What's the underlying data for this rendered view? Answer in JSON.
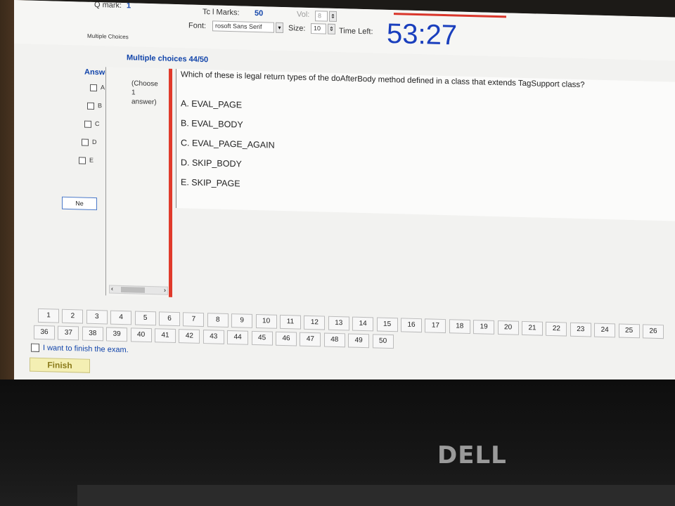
{
  "header": {
    "q_mark_label": "Q mark:",
    "q_mark_value": "1",
    "total_marks_label": "Tc  l Marks:",
    "total_marks_value": "50",
    "vol_label": "Vol:",
    "vol_value": "8",
    "font_label": "Font:",
    "font_value": "rosoft Sans Serif",
    "size_label": "Size:",
    "size_value": "10",
    "time_left_label": "Time Left:",
    "timer": "53:27",
    "mode": "Multiple Choices"
  },
  "section_title": "Multiple choices 44/50",
  "answer_panel": {
    "heading": "Answer",
    "options": [
      "A",
      "B",
      "C",
      "D",
      "E"
    ],
    "next_label": "Ne"
  },
  "hint": {
    "line1": "(Choose",
    "line2": "1",
    "line3": "answer)"
  },
  "question": {
    "text": "Which of these is legal return types of the doAfterBody method defined in a class that extends TagSupport class?",
    "options": [
      "A. EVAL_PAGE",
      "B. EVAL_BODY",
      "C. EVAL_PAGE_AGAIN",
      "D. SKIP_BODY",
      "E. SKIP_PAGE"
    ]
  },
  "navigation": {
    "row1": [
      "1",
      "2",
      "3",
      "4",
      "5",
      "6",
      "7",
      "8",
      "9",
      "10",
      "11",
      "12",
      "13",
      "14",
      "15",
      "16",
      "17",
      "18",
      "19",
      "20",
      "21",
      "22",
      "23",
      "24",
      "25",
      "26"
    ],
    "row2": [
      "36",
      "37",
      "38",
      "39",
      "40",
      "41",
      "42",
      "43",
      "44",
      "45",
      "46",
      "47",
      "48",
      "49",
      "50"
    ]
  },
  "finish": {
    "checkbox_label": "I want to finish the exam.",
    "button_label": "Finish"
  },
  "device": {
    "brand": "DELL"
  },
  "colors": {
    "timer": "#1a3fbd",
    "accent_red": "#e03a2b",
    "finish_bg": "#f4efb3"
  }
}
